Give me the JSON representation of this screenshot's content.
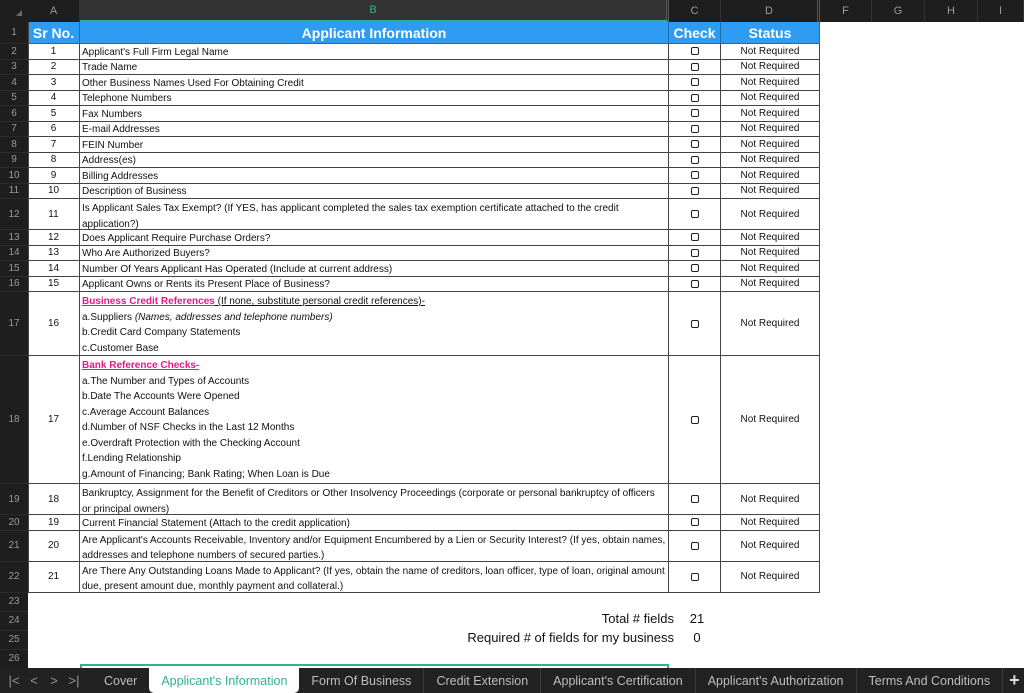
{
  "columns": [
    "A",
    "B",
    "C",
    "D",
    "F",
    "G",
    "H",
    "I"
  ],
  "active_column": "B",
  "row_numbers": [
    "1",
    "2",
    "3",
    "4",
    "5",
    "6",
    "7",
    "8",
    "9",
    "10",
    "11",
    "12",
    "13",
    "14",
    "15",
    "16",
    "17",
    "18",
    "19",
    "20",
    "21",
    "22",
    "23",
    "24",
    "25",
    "26"
  ],
  "table": {
    "headers": {
      "sr": "Sr No.",
      "info": "Applicant Information",
      "check": "Check",
      "status": "Status"
    },
    "rows": [
      {
        "sr": "1",
        "text": "Applicant's Full Firm Legal Name",
        "status": "Not Required",
        "checked": false
      },
      {
        "sr": "2",
        "text": "Trade Name",
        "status": "Not Required",
        "checked": false
      },
      {
        "sr": "3",
        "text": "Other Business Names Used For Obtaining Credit",
        "status": "Not Required",
        "checked": false
      },
      {
        "sr": "4",
        "text": "Telephone Numbers",
        "status": "Not Required",
        "checked": false
      },
      {
        "sr": "5",
        "text": "Fax Numbers",
        "status": "Not Required",
        "checked": false
      },
      {
        "sr": "6",
        "text": "E-mail Addresses",
        "status": "Not Required",
        "checked": false
      },
      {
        "sr": "7",
        "text": "FEIN Number",
        "status": "Not Required",
        "checked": false
      },
      {
        "sr": "8",
        "text": "Address(es)",
        "status": "Not Required",
        "checked": false
      },
      {
        "sr": "9",
        "text": "Billing Addresses",
        "status": "Not Required",
        "checked": false
      },
      {
        "sr": "10",
        "text": "Description of Business",
        "status": "Not Required",
        "checked": false
      },
      {
        "sr": "11",
        "text": "Is Applicant Sales Tax Exempt?  (If YES, has applicant completed the sales tax exemption certificate attached to the credit application?)",
        "status": "Not Required",
        "checked": false
      },
      {
        "sr": "12",
        "text": "Does Applicant Require Purchase Orders?",
        "status": "Not Required",
        "checked": false
      },
      {
        "sr": "13",
        "text": "Who Are Authorized Buyers?",
        "status": "Not Required",
        "checked": false
      },
      {
        "sr": "14",
        "text": "Number Of Years Applicant Has Operated (Include at current address)",
        "status": "Not Required",
        "checked": false
      },
      {
        "sr": "15",
        "text": "Applicant Owns or Rents its Present Place of Business?",
        "status": "Not Required",
        "checked": false
      },
      {
        "sr": "16",
        "heading": "Business Credit References",
        "heading_suffix": " (If none, substitute personal credit references)-",
        "lines": [
          "a.Suppliers ",
          "b.Credit Card Company Statements",
          "c.Customer Base"
        ],
        "line1_italic": "(Names, addresses and telephone numbers)",
        "status": "Not Required",
        "checked": false
      },
      {
        "sr": "17",
        "heading": "Bank Reference Checks-",
        "lines": [
          "a.The Number and Types of Accounts",
          "b.Date The Accounts Were Opened",
          "c.Average Account Balances",
          "d.Number of NSF Checks in the Last 12 Months",
          "e.Overdraft Protection with the Checking Account",
          "f.Lending Relationship",
          "g.Amount of Financing; Bank Rating; When Loan is Due"
        ],
        "status": "Not Required",
        "checked": false
      },
      {
        "sr": "18",
        "text": "Bankruptcy, Assignment for the Benefit of Creditors or Other Insolvency Proceedings (corporate or personal bankruptcy of officers or principal owners)",
        "status": "Not Required",
        "checked": false
      },
      {
        "sr": "19",
        "text": "Current Financial Statement (Attach to the credit application)",
        "status": "Not Required",
        "checked": false
      },
      {
        "sr": "20",
        "text": "Are Applicant's Accounts Receivable, Inventory and/or Equipment Encumbered by a Lien or Security Interest? (If yes, obtain names, addresses and telephone numbers of secured parties.)",
        "status": "Not Required",
        "checked": false
      },
      {
        "sr": "21",
        "text": "Are There Any Outstanding Loans Made to Applicant?  (If yes, obtain the name of creditors, loan officer, type of loan, original amount due, present amount due, monthly payment and collateral.)",
        "status": "Not Required",
        "checked": false
      }
    ]
  },
  "totals": {
    "total_label": "Total # fields",
    "total_value": "21",
    "required_label": "Required # of fields for my business",
    "required_value": "0"
  },
  "sheet_nav": [
    "|<",
    "<",
    ">",
    ">|"
  ],
  "sheet_tabs": [
    {
      "label": "Cover",
      "active": false
    },
    {
      "label": "Applicant's Information",
      "active": true
    },
    {
      "label": "Form Of Business",
      "active": false
    },
    {
      "label": "Credit Extension",
      "active": false
    },
    {
      "label": "Applicant's Certification",
      "active": false
    },
    {
      "label": "Applicant's Authorization",
      "active": false
    },
    {
      "label": "Terms And Conditions",
      "active": false
    }
  ],
  "add_sheet_label": "+"
}
